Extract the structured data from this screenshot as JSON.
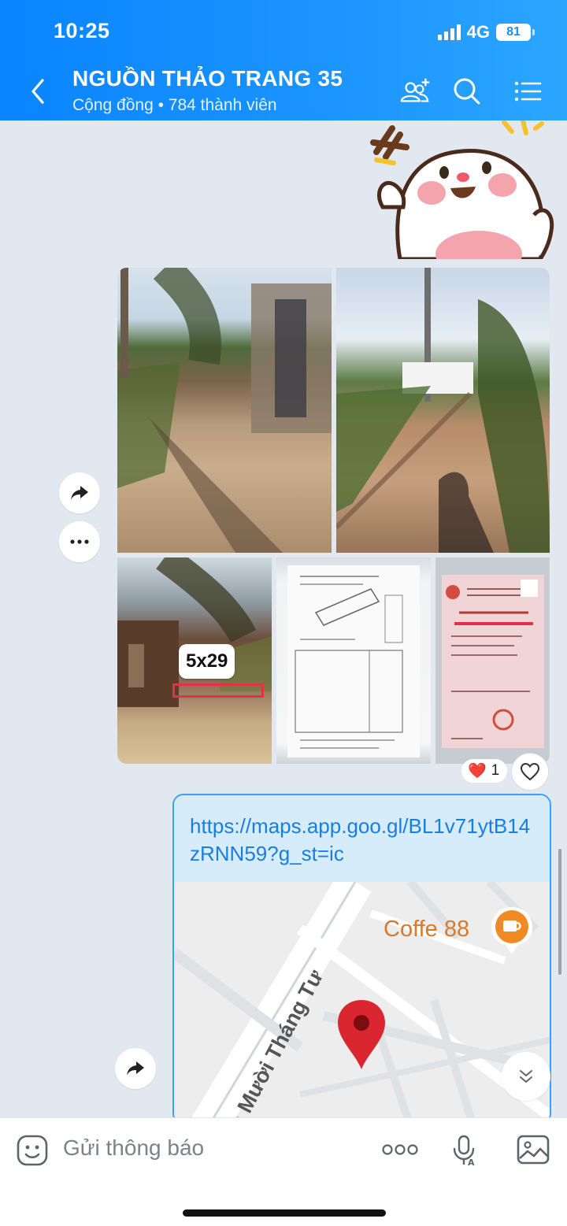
{
  "status_bar": {
    "time": "10:25",
    "network": "4G",
    "battery": "81"
  },
  "header": {
    "title": "NGUỒN THẢO TRANG 35",
    "subtitle": "Cộng đồng • 784 thành viên",
    "icons": [
      "back-icon",
      "add-member-icon",
      "search-icon",
      "menu-icon"
    ]
  },
  "messages": {
    "photo_overlay_label": "5x29",
    "reaction": {
      "emoji": "❤️",
      "count": "1"
    },
    "link": {
      "url": "https://maps.app.goo.gl/BL1v71ytB14zRNN59?g_st=ic",
      "map_place": "Coffe 88",
      "map_street": "a Mười Tháng Tư"
    }
  },
  "input": {
    "placeholder": "Gửi thông báo"
  },
  "colors": {
    "header": "#1c8cf7",
    "link": "#1a7ee0",
    "pin": "#d9262f",
    "background": "#e2e8ef"
  }
}
